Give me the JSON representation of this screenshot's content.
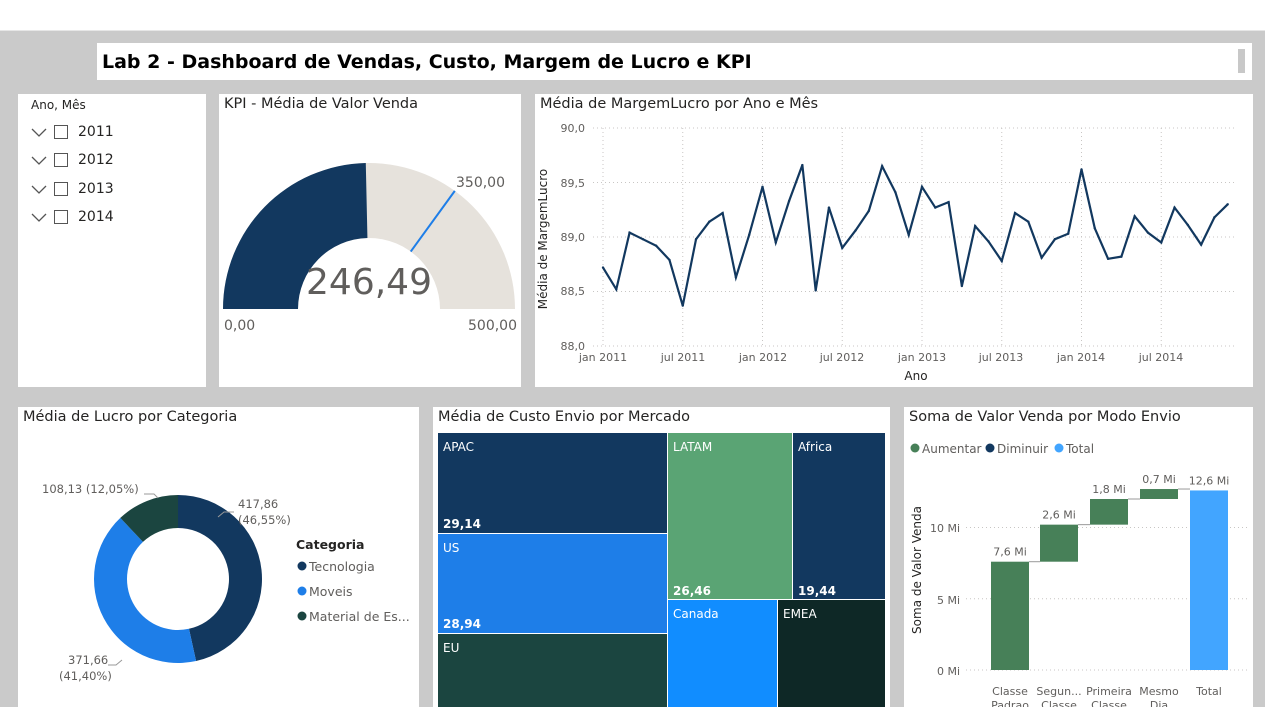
{
  "header": {
    "title": "Lab 2 - Dashboard de Vendas, Custo, Margem de Lucro e KPI"
  },
  "slicer": {
    "label": "Ano, Mês",
    "items": [
      {
        "label": "2011"
      },
      {
        "label": "2012"
      },
      {
        "label": "2013"
      },
      {
        "label": "2014"
      }
    ]
  },
  "colors": {
    "dark_blue": "#12385f",
    "mid_blue": "#1e7ee8",
    "dark_green": "#1b4540",
    "green": "#5aa474",
    "light_blue": "#118dff",
    "gauge_bg": "#e6e2dc",
    "waterfall_green": "#478058",
    "waterfall_total": "#42a5ff"
  },
  "gauge": {
    "title": "KPI - Média de Valor Venda",
    "value": 246.49,
    "value_label": "246,49",
    "min_label": "0,00",
    "max_label": "500,00",
    "target_label": "350,00",
    "min": 0,
    "max": 500,
    "target": 350
  },
  "line": {
    "title": "Média de MargemLucro por Ano e Mês",
    "xlabel": "Ano",
    "ylabel": "Média de MargemLucro",
    "y_ticks": [
      "90,0",
      "89,5",
      "89,0",
      "88,5",
      "88,0"
    ],
    "x_ticks": [
      "jan 2011",
      "jul 2011",
      "jan 2012",
      "jul 2012",
      "jan 2013",
      "jul 2013",
      "jan 2014",
      "jul 2014"
    ]
  },
  "donut": {
    "title": "Média de Lucro por Categoria",
    "legend_title": "Categoria",
    "legend": [
      {
        "label": "Tecnologia",
        "color": "#12385f"
      },
      {
        "label": "Moveis",
        "color": "#1e7ee8"
      },
      {
        "label": "Material de Es...",
        "color": "#1b4540"
      }
    ],
    "labels": {
      "tec_value": "417,86",
      "tec_pct": "(46,55%)",
      "mov_value": "371,66",
      "mov_pct": "(41,40%)",
      "mat": "108,13 (12,05%)"
    }
  },
  "treemap": {
    "title": "Média de Custo Envio por Mercado",
    "cells": [
      {
        "name": "APAC",
        "value": "29,14"
      },
      {
        "name": "US",
        "value": "28,94"
      },
      {
        "name": "EU",
        "value": ""
      },
      {
        "name": "LATAM",
        "value": "26,46"
      },
      {
        "name": "Africa",
        "value": "19,44"
      },
      {
        "name": "Canada",
        "value": ""
      },
      {
        "name": "EMEA",
        "value": ""
      }
    ]
  },
  "waterfall": {
    "title": "Soma de Valor Venda por Modo Envio",
    "legend": [
      {
        "label": "Aumentar",
        "color": "#478058"
      },
      {
        "label": "Diminuir",
        "color": "#12385f"
      },
      {
        "label": "Total",
        "color": "#42a5ff"
      }
    ],
    "ylabel": "Soma de Valor Venda",
    "y_ticks": [
      "10 Mi",
      "5 Mi",
      "0 Mi"
    ],
    "bar_labels": [
      "7,6 Mi",
      "2,6 Mi",
      "1,8 Mi",
      "0,7 Mi",
      "12,6 Mi"
    ],
    "categories_line1": [
      "Classe",
      "Segun...",
      "Primeira",
      "Mesmo",
      "Total"
    ],
    "categories_line2": [
      "Padrao",
      "Classe",
      "Classe",
      "Dia",
      ""
    ]
  },
  "chart_data": [
    {
      "type": "line",
      "title": "Média de MargemLucro por Ano e Mês",
      "xlabel": "Ano",
      "ylabel": "Média de MargemLucro",
      "ylim": [
        88.0,
        90.0
      ],
      "x": [
        "jan 2011",
        "fev 2011",
        "mar 2011",
        "abr 2011",
        "mai 2011",
        "jun 2011",
        "jul 2011",
        "ago 2011",
        "set 2011",
        "out 2011",
        "nov 2011",
        "dez 2011",
        "jan 2012",
        "fev 2012",
        "mar 2012",
        "abr 2012",
        "mai 2012",
        "jun 2012",
        "jul 2012",
        "ago 2012",
        "set 2012",
        "out 2012",
        "nov 2012",
        "dez 2012",
        "jan 2013",
        "fev 2013",
        "mar 2013",
        "abr 2013",
        "mai 2013",
        "jun 2013",
        "jul 2013",
        "ago 2013",
        "set 2013",
        "out 2013",
        "nov 2013",
        "dez 2013",
        "jan 2014",
        "fev 2014",
        "mar 2014",
        "abr 2014",
        "mai 2014",
        "jun 2014",
        "jul 2014",
        "ago 2014",
        "set 2014",
        "out 2014",
        "nov 2014",
        "dez 2014"
      ],
      "values": [
        88.72,
        88.52,
        89.04,
        88.98,
        88.92,
        88.79,
        88.37,
        88.98,
        89.14,
        89.22,
        88.63,
        89.02,
        89.46,
        88.95,
        89.33,
        89.66,
        88.51,
        89.27,
        88.9,
        89.06,
        89.24,
        89.65,
        89.41,
        89.02,
        89.46,
        89.27,
        89.32,
        88.55,
        89.1,
        88.96,
        88.78,
        89.22,
        89.14,
        88.81,
        88.98,
        89.03,
        89.62,
        89.08,
        88.8,
        88.82,
        89.19,
        89.04,
        88.95,
        89.27,
        89.11,
        88.93,
        89.18,
        89.3
      ]
    },
    {
      "type": "pie",
      "title": "Média de Lucro por Categoria",
      "categories": [
        "Tecnologia",
        "Moveis",
        "Material de Es..."
      ],
      "values": [
        417.86,
        371.66,
        108.13
      ],
      "percent": [
        46.55,
        41.4,
        12.05
      ]
    },
    {
      "type": "heatmap",
      "title": "Média de Custo Envio por Mercado",
      "categories": [
        "APAC",
        "US",
        "EU",
        "LATAM",
        "Africa",
        "Canada",
        "EMEA"
      ],
      "values": [
        29.14,
        28.94,
        null,
        26.46,
        19.44,
        null,
        null
      ]
    },
    {
      "type": "bar",
      "title": "Soma de Valor Venda por Modo Envio",
      "ylabel": "Soma de Valor Venda",
      "categories": [
        "Classe Padrao",
        "Segun... Classe",
        "Primeira Classe",
        "Mesmo Dia",
        "Total"
      ],
      "values": [
        7.6,
        2.6,
        1.8,
        0.7,
        12.6
      ],
      "ylim": [
        0,
        12.6
      ]
    }
  ]
}
